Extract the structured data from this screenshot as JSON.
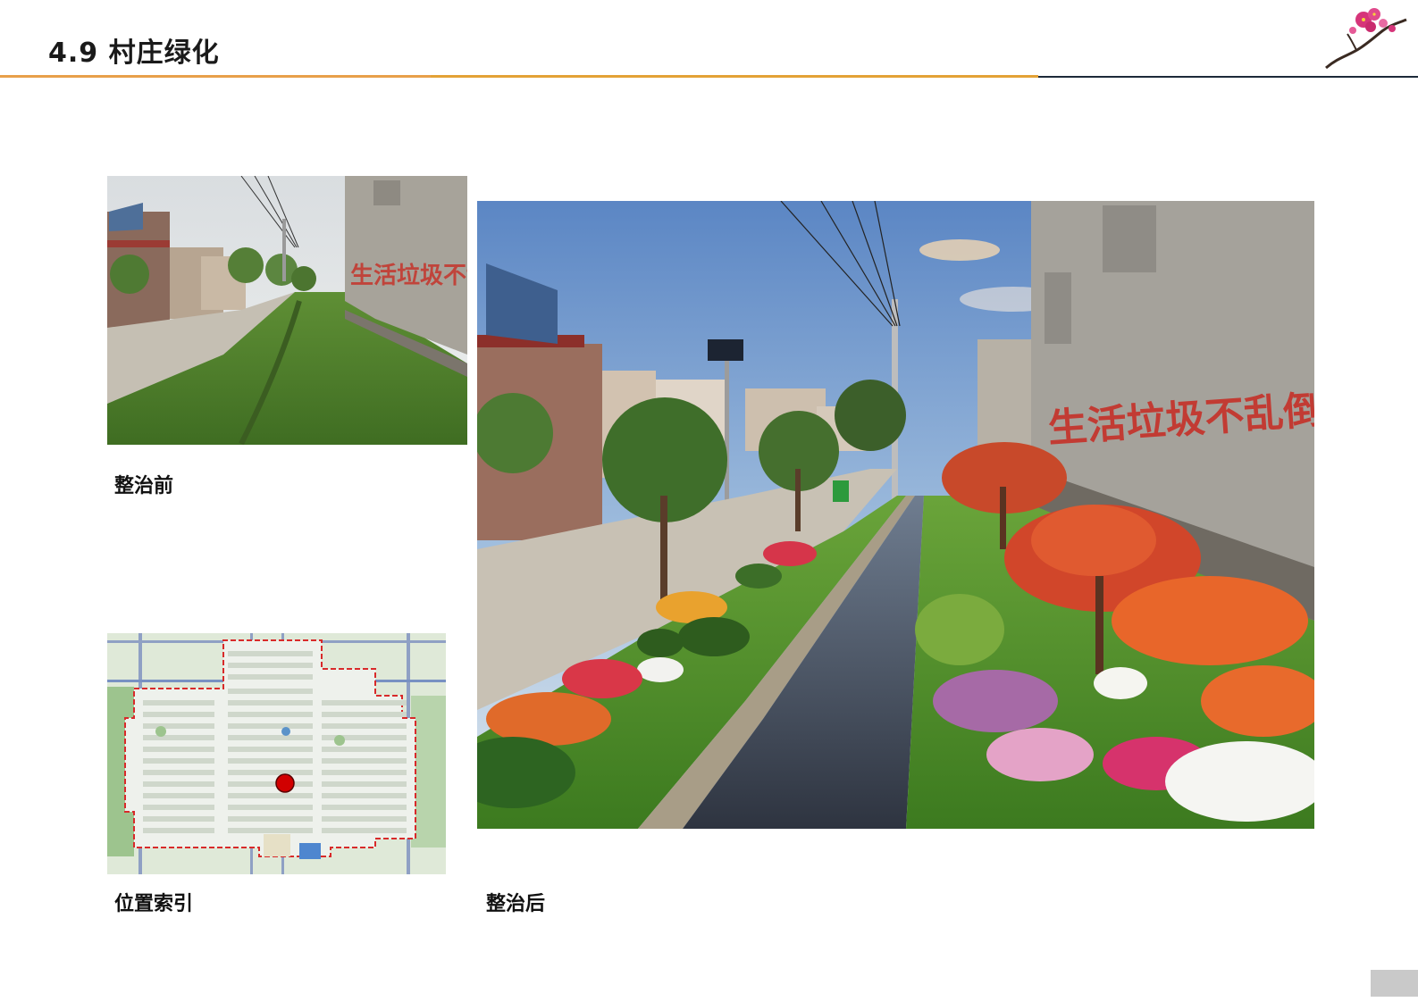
{
  "header": {
    "section_title": "4.9 村庄绿化",
    "logo_icon": "plum-blossom-icon"
  },
  "photos": {
    "before": {
      "caption": "整治前",
      "wall_slogan": "生活垃圾不乱倒,村庄绿"
    },
    "after": {
      "caption": "整治后",
      "wall_slogan": "生活垃圾不乱倒,村庄绿"
    },
    "location_map": {
      "caption": "位置索引"
    }
  },
  "colors": {
    "accent_orange": "#e8a04a",
    "accent_gold": "#e3a236",
    "rule_dark": "#1d2a3a",
    "marker_red": "#d10000",
    "boundary_red": "#d82a2a"
  }
}
